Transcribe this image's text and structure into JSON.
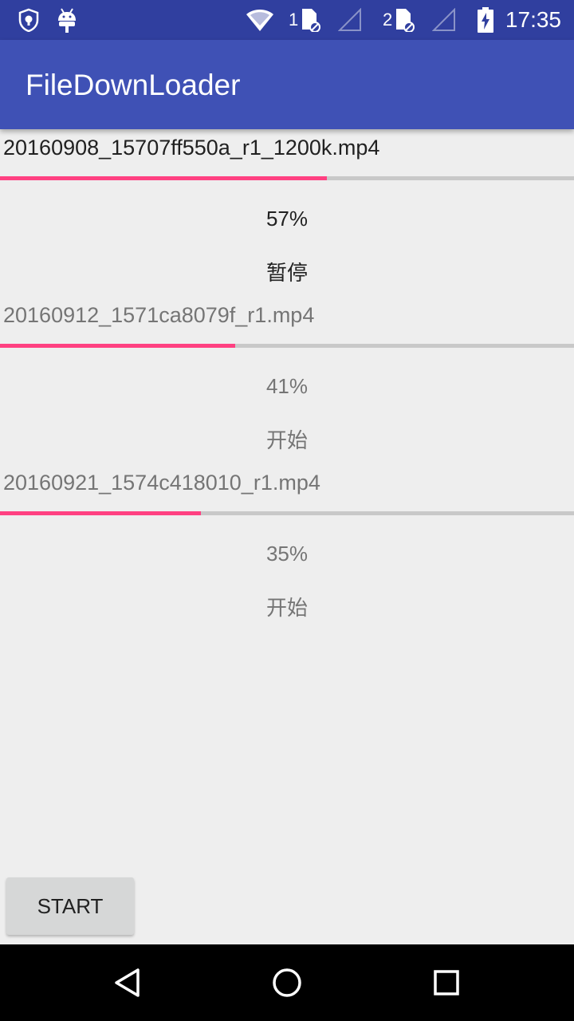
{
  "status_bar": {
    "time": "17:35",
    "sim1_label": "1",
    "sim2_label": "2",
    "icons": [
      "shield-icon",
      "android-icon",
      "wifi-icon",
      "sim1-icon",
      "signal1-icon",
      "sim2-icon",
      "signal2-icon",
      "battery-charging-icon"
    ]
  },
  "app_bar": {
    "title": "FileDownLoader"
  },
  "downloads": [
    {
      "file_name": "20160908_15707ff550a_r1_1200k.mp4",
      "progress_percent": 57,
      "progress_label": "57%",
      "action_label": "暂停"
    },
    {
      "file_name": "20160912_1571ca8079f_r1.mp4",
      "progress_percent": 41,
      "progress_label": "41%",
      "action_label": "开始"
    },
    {
      "file_name": "20160921_1574c418010_r1.mp4",
      "progress_percent": 35,
      "progress_label": "35%",
      "action_label": "开始"
    }
  ],
  "start_button": {
    "label": "START"
  },
  "nav_bar": {
    "icons": [
      "back-icon",
      "home-icon",
      "recents-icon"
    ]
  },
  "colors": {
    "status_bar": "#303F9F",
    "app_bar": "#3F51B5",
    "accent": "#FF4081",
    "background": "#EEEEEE"
  }
}
